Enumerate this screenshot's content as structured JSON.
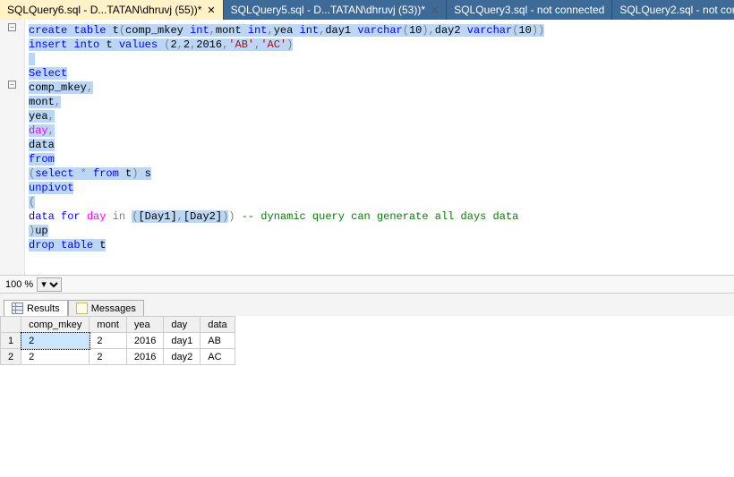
{
  "tabs": [
    {
      "label": "SQLQuery6.sql - D...TATAN\\dhruvj (55))*",
      "active": true,
      "closable": true
    },
    {
      "label": "SQLQuery5.sql - D...TATAN\\dhruvj (53))*",
      "active": false,
      "closable": true
    },
    {
      "label": "SQLQuery3.sql - not connected",
      "active": false,
      "closable": false
    },
    {
      "label": "SQLQuery2.sql - not con",
      "active": false,
      "closable": false
    }
  ],
  "zoom": "100 %",
  "result_tabs": {
    "results": "Results",
    "messages": "Messages"
  },
  "columns": [
    "comp_mkey",
    "mont",
    "yea",
    "day",
    "data"
  ],
  "rows": [
    {
      "n": "1",
      "comp_mkey": "2",
      "mont": "2",
      "yea": "2016",
      "day": "day1",
      "data": "AB"
    },
    {
      "n": "2",
      "comp_mkey": "2",
      "mont": "2",
      "yea": "2016",
      "day": "day2",
      "data": "AC"
    }
  ],
  "sql": {
    "l1_a": "create",
    "l1_b": "table",
    "l1_c": "t",
    "l1_d": "comp_mkey",
    "l1_e": "int",
    "l1_f": "mont",
    "l1_g": "int",
    "l1_h": "yea",
    "l1_i": "int",
    "l1_j": "day1",
    "l1_k": "varchar",
    "l1_l": "10",
    "l1_m": "day2",
    "l1_n": "varchar",
    "l1_o": "10",
    "l2_a": "insert",
    "l2_b": "into",
    "l2_c": "t",
    "l2_d": "values",
    "l2_e": "2",
    "l2_f": "2",
    "l2_g": "2016",
    "l2_h": "'AB'",
    "l2_i": "'AC'",
    "l4_a": "Select",
    "l5_a": "comp_mkey",
    "l6_a": "mont",
    "l7_a": "yea",
    "l8_a": "day",
    "l9_a": "data",
    "l10_a": "from",
    "l11_a": "select",
    "l11_b": "*",
    "l11_c": "from",
    "l11_d": "t",
    "l11_e": "s",
    "l12_a": "unpivot",
    "l14_a": "data",
    "l14_b": "for",
    "l14_c": "day",
    "l14_d": "in",
    "l14_e": "[Day1]",
    "l14_f": "[Day2]",
    "l14_g": "-- dynamic query can generate all days data",
    "l15_a": "up",
    "l16_a": "drop",
    "l16_b": "table",
    "l16_c": "t"
  }
}
